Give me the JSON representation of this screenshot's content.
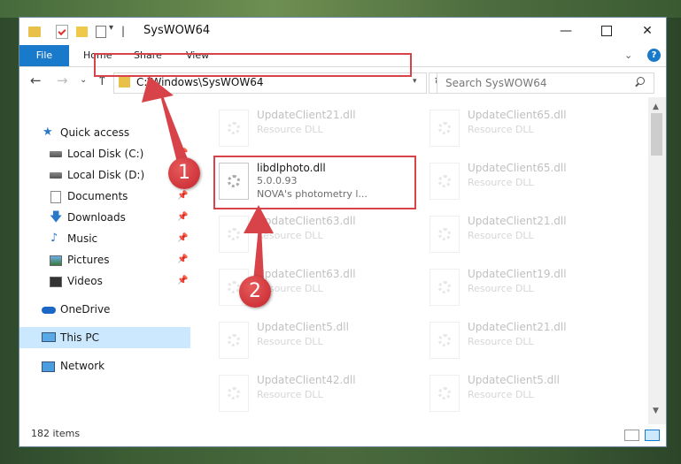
{
  "window": {
    "title": "SysWOW64",
    "minimize": "—",
    "maximize": "",
    "close": "✕"
  },
  "ribbon": {
    "tabs": [
      "File",
      "Home",
      "Share",
      "View"
    ]
  },
  "address": {
    "path": "C:\\Windows\\SysWOW64",
    "search_placeholder": "Search SysWOW64"
  },
  "nav": {
    "items": [
      {
        "label": "Quick access",
        "icon": "star-icon"
      },
      {
        "label": "Local Disk (C:)",
        "icon": "disk-icon",
        "pinned": true
      },
      {
        "label": "Local Disk (D:)",
        "icon": "disk-icon"
      },
      {
        "label": "Documents",
        "icon": "documents-icon",
        "pinned": true
      },
      {
        "label": "Downloads",
        "icon": "download-icon",
        "pinned": true
      },
      {
        "label": "Music",
        "icon": "music-icon",
        "pinned": true
      },
      {
        "label": "Pictures",
        "icon": "pictures-icon",
        "pinned": true
      },
      {
        "label": "Videos",
        "icon": "videos-icon",
        "pinned": true
      },
      {
        "label": "OneDrive",
        "icon": "cloud-icon"
      },
      {
        "label": "This PC",
        "icon": "pc-icon",
        "selected": true
      },
      {
        "label": "Network",
        "icon": "network-icon"
      }
    ]
  },
  "files": {
    "left": [
      {
        "name": "UpdateClient21.dll",
        "desc": "Resource DLL"
      },
      {
        "name": "libdlphoto.dll",
        "version": "5.0.0.93",
        "desc": "NOVA's photometry l..."
      },
      {
        "name": "UpdateClient63.dll",
        "desc": "Resource DLL"
      },
      {
        "name": "UpdateClient63.dll",
        "desc": "Resource DLL"
      },
      {
        "name": "UpdateClient5.dll",
        "desc": "Resource DLL"
      },
      {
        "name": "UpdateClient42.dll",
        "desc": "Resource DLL"
      }
    ],
    "right": [
      {
        "name": "UpdateClient65.dll",
        "desc": "Resource DLL"
      },
      {
        "name": "UpdateClient65.dll",
        "desc": "Resource DLL"
      },
      {
        "name": "UpdateClient21.dll",
        "desc": "Resource DLL"
      },
      {
        "name": "UpdateClient19.dll",
        "desc": "Resource DLL"
      },
      {
        "name": "UpdateClient21.dll",
        "desc": "Resource DLL"
      },
      {
        "name": "UpdateClient5.dll",
        "desc": "Resource DLL"
      }
    ]
  },
  "status": {
    "item_count": "182 items"
  },
  "annotations": {
    "step1": "1",
    "step2": "2",
    "color": "#d8434a"
  }
}
